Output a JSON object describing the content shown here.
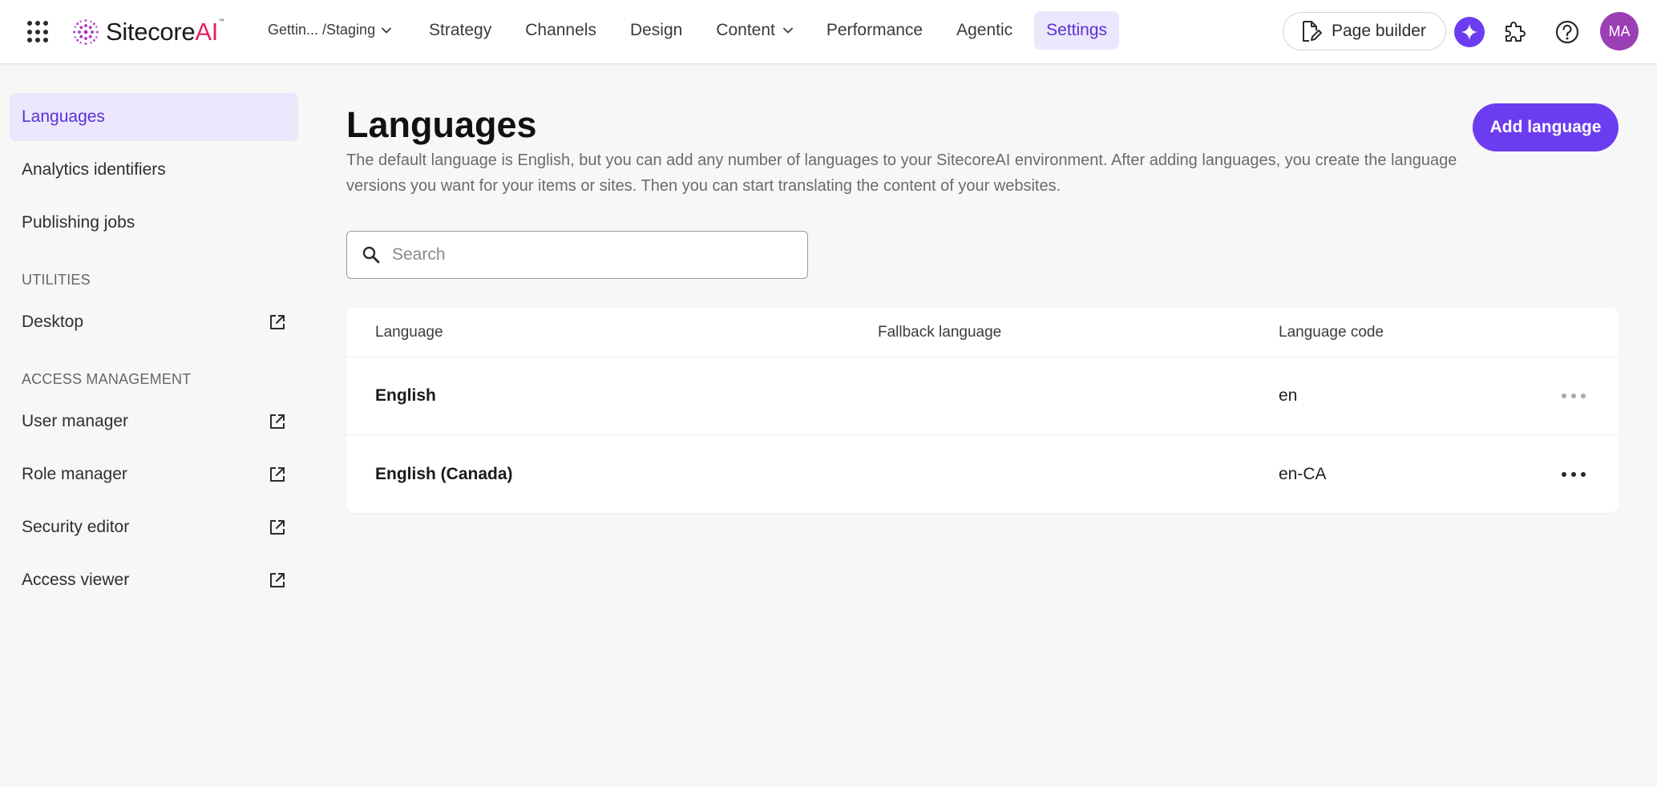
{
  "header": {
    "brand": {
      "name_main": "Sitecore",
      "name_accent": "AI",
      "trademark": "™"
    },
    "environment": "Gettin... /Staging",
    "nav": [
      {
        "label": "Strategy",
        "active": false,
        "has_menu": false
      },
      {
        "label": "Channels",
        "active": false,
        "has_menu": false
      },
      {
        "label": "Design",
        "active": false,
        "has_menu": false
      },
      {
        "label": "Content",
        "active": false,
        "has_menu": true
      },
      {
        "label": "Performance",
        "active": false,
        "has_menu": false
      },
      {
        "label": "Agentic",
        "active": false,
        "has_menu": false
      },
      {
        "label": "Settings",
        "active": true,
        "has_menu": false
      }
    ],
    "page_builder_label": "Page builder",
    "avatar_initials": "MA",
    "icons": {
      "apps": "apps-grid-icon",
      "ai": "sparkle-icon",
      "extensions": "puzzle-icon",
      "help": "help-icon"
    }
  },
  "sidebar": {
    "items": [
      {
        "label": "Languages",
        "active": true,
        "external": false
      },
      {
        "label": "Analytics identifiers",
        "active": false,
        "external": false
      },
      {
        "label": "Publishing jobs",
        "active": false,
        "external": false
      }
    ],
    "utilities_title": "UTILITIES",
    "utilities": [
      {
        "label": "Desktop",
        "external": true
      }
    ],
    "access_title": "ACCESS MANAGEMENT",
    "access": [
      {
        "label": "User manager",
        "external": true
      },
      {
        "label": "Role manager",
        "external": true
      },
      {
        "label": "Security editor",
        "external": true
      },
      {
        "label": "Access viewer",
        "external": true
      }
    ]
  },
  "main": {
    "title": "Languages",
    "description": "The default language is English, but you can add any number of languages to your SitecoreAI environment. After adding languages, you create the language versions you want for your items or sites. Then you can start translating the content of your websites.",
    "add_button": "Add language",
    "search_placeholder": "Search",
    "search_value": "",
    "table": {
      "columns": [
        "Language",
        "Fallback language",
        "Language code"
      ],
      "rows": [
        {
          "language": "English",
          "fallback": "",
          "code": "en",
          "actions_enabled": false
        },
        {
          "language": "English (Canada)",
          "fallback": "",
          "code": "en-CA",
          "actions_enabled": true
        }
      ]
    }
  },
  "colors": {
    "accent": "#6c3cf0",
    "accent_soft": "#ebe7fc",
    "accent_text": "#5b2fd6",
    "avatar": "#9b3fb5",
    "more_disabled": "#a9a9a9",
    "more_enabled": "#2a2a2a"
  }
}
